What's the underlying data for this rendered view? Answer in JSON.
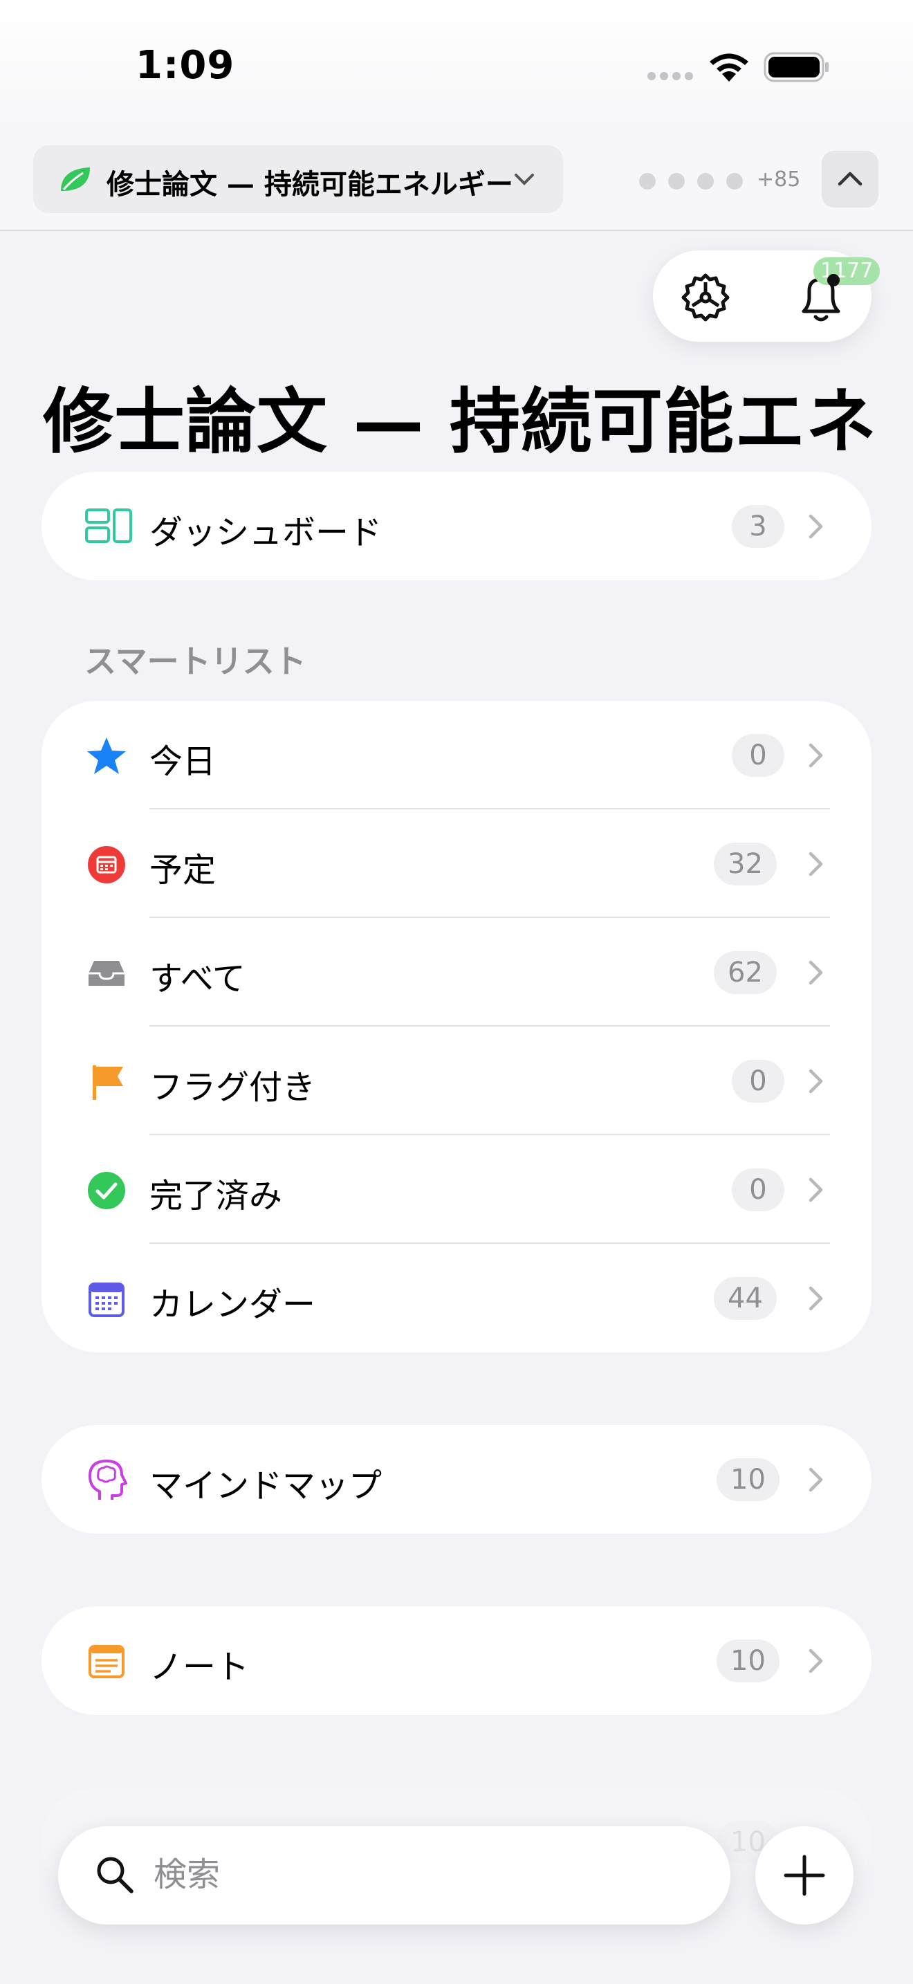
{
  "status_bar": {
    "time": "1:09"
  },
  "workspace": {
    "title": "修士論文 — 持続可能エネルギー",
    "more_members": "+85"
  },
  "notifications": {
    "badge_count": "1177"
  },
  "page": {
    "title": "修士論文 — 持続可能エネ…"
  },
  "dashboard": {
    "label": "ダッシュボード",
    "count": "3",
    "icon": "dashboard-icon"
  },
  "smart_lists": {
    "header": "スマートリスト",
    "items": [
      {
        "label": "今日",
        "count": "0",
        "icon": "star-icon",
        "color": "#1a82f7"
      },
      {
        "label": "予定",
        "count": "32",
        "icon": "calendar-badge-icon",
        "color": "#ee3b37"
      },
      {
        "label": "すべて",
        "count": "62",
        "icon": "tray-icon",
        "color": "#8e8e93"
      },
      {
        "label": "フラグ付き",
        "count": "0",
        "icon": "flag-icon",
        "color": "#f79a2c"
      },
      {
        "label": "完了済み",
        "count": "0",
        "icon": "checkmark-circle-icon",
        "color": "#34c759"
      },
      {
        "label": "カレンダー",
        "count": "44",
        "icon": "calendar-grid-icon",
        "color": "#5e5ce6"
      }
    ]
  },
  "mind_map": {
    "label": "マインドマップ",
    "count": "10",
    "icon": "brain-head-icon",
    "color": "#c940e0"
  },
  "notes": {
    "label": "ノート",
    "count": "10",
    "icon": "note-icon",
    "color": "#f79a2c"
  },
  "partial_item": {
    "count": "10"
  },
  "search": {
    "placeholder": "検索"
  }
}
